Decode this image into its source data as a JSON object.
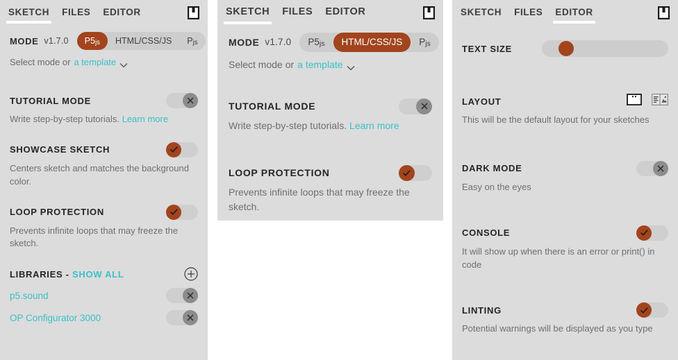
{
  "colors": {
    "accent": "#a2441d",
    "link": "#3ac0c8",
    "panel_bg": "#dcdcdc",
    "toggle_off_knob": "#8c8c8c",
    "page_bg": "#ffffff"
  },
  "tabs": {
    "sketch": "SKETCH",
    "files": "FILES",
    "editor": "EDITOR"
  },
  "icons": {
    "save": "save-icon",
    "chevron_down": "chevron-down-icon",
    "plus": "plus-icon",
    "check": "check-icon",
    "close": "close-icon"
  },
  "panel1": {
    "active_tab": "SKETCH",
    "mode": {
      "label": "MODE",
      "version": "v1.7.0",
      "options": [
        "P5js",
        "HTML/CSS/JS",
        "Pjs"
      ],
      "selected": "P5js",
      "hint_prefix": "Select mode or ",
      "hint_link": "a template"
    },
    "settings": [
      {
        "title": "TUTORIAL MODE",
        "desc": "Write step-by-step tutorials. ",
        "link": "Learn more",
        "state": "off"
      },
      {
        "title": "SHOWCASE SKETCH",
        "desc": "Centers sketch and matches the background color.",
        "link": "",
        "state": "on"
      },
      {
        "title": "LOOP PROTECTION",
        "desc": "Prevents infinite loops that may freeze the sketch.",
        "link": "",
        "state": "on"
      }
    ],
    "libraries": {
      "title": "LIBRARIES",
      "dash": " - ",
      "show_all": "SHOW ALL",
      "items": [
        {
          "name": "p5.sound",
          "state": "off"
        },
        {
          "name": "OP Configurator 3000",
          "state": "off"
        }
      ]
    }
  },
  "panel2": {
    "active_tab": "SKETCH",
    "mode": {
      "label": "MODE",
      "version": "v1.7.0",
      "options": [
        "P5js",
        "HTML/CSS/JS",
        "Pjs"
      ],
      "selected": "HTML/CSS/JS",
      "hint_prefix": "Select mode or ",
      "hint_link": "a template"
    },
    "settings": [
      {
        "title": "TUTORIAL MODE",
        "desc": "Write step-by-step tutorials. ",
        "link": "Learn more",
        "state": "off"
      },
      {
        "title": "LOOP PROTECTION",
        "desc": "Prevents infinite loops that may freeze the sketch.",
        "link": "",
        "state": "on"
      }
    ]
  },
  "panel3": {
    "active_tab": "EDITOR",
    "text_size": {
      "title": "TEXT SIZE",
      "thumb_position_pct": 13
    },
    "layout": {
      "title": "LAYOUT",
      "desc": "This will be the default layout for your sketches",
      "options": [
        "single-view-layout-icon",
        "split-view-layout-icon"
      ]
    },
    "settings": [
      {
        "title": "DARK MODE",
        "desc": "Easy on the eyes",
        "state": "off"
      },
      {
        "title": "CONSOLE",
        "desc": "It will show up when there is an error or print() in code",
        "state": "on"
      },
      {
        "title": "LINTING",
        "desc": "Potential warnings will be displayed as you type",
        "state": "on"
      }
    ]
  }
}
